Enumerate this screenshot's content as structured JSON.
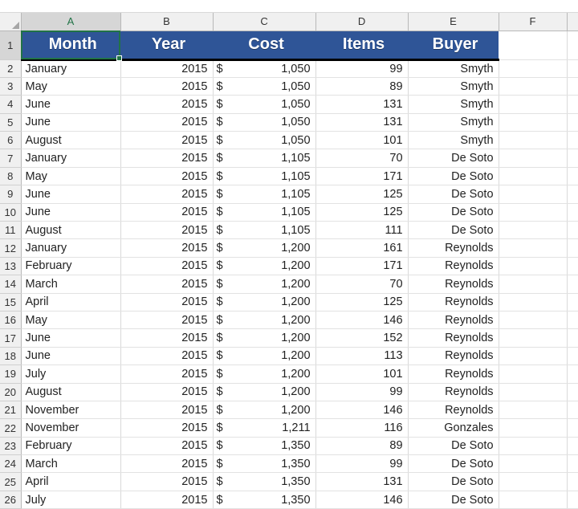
{
  "app": {
    "name": "spreadsheet",
    "accent_color": "#2f5597",
    "selection_color": "#217346"
  },
  "grid": {
    "select_all_icon": "select-all-triangle-icon",
    "column_letters": [
      "A",
      "B",
      "C",
      "D",
      "E",
      "F"
    ],
    "selected_column": "A",
    "selected_cell": "A1",
    "row_numbers": [
      1,
      2,
      3,
      4,
      5,
      6,
      7,
      8,
      9,
      10,
      11,
      12,
      13,
      14,
      15,
      16,
      17,
      18,
      19,
      20,
      21,
      22,
      23,
      24,
      25,
      26
    ]
  },
  "table": {
    "headers": [
      "Month",
      "Year",
      "Cost",
      "Items",
      "Buyer"
    ],
    "currency_symbol": "$",
    "rows": [
      {
        "row": 2,
        "month": "January",
        "year": "2015",
        "cost": "1,050",
        "items": "99",
        "buyer": "Smyth"
      },
      {
        "row": 3,
        "month": "May",
        "year": "2015",
        "cost": "1,050",
        "items": "89",
        "buyer": "Smyth"
      },
      {
        "row": 4,
        "month": "June",
        "year": "2015",
        "cost": "1,050",
        "items": "131",
        "buyer": "Smyth"
      },
      {
        "row": 5,
        "month": "June",
        "year": "2015",
        "cost": "1,050",
        "items": "131",
        "buyer": "Smyth"
      },
      {
        "row": 6,
        "month": "August",
        "year": "2015",
        "cost": "1,050",
        "items": "101",
        "buyer": "Smyth"
      },
      {
        "row": 7,
        "month": "January",
        "year": "2015",
        "cost": "1,105",
        "items": "70",
        "buyer": "De Soto"
      },
      {
        "row": 8,
        "month": "May",
        "year": "2015",
        "cost": "1,105",
        "items": "171",
        "buyer": "De Soto"
      },
      {
        "row": 9,
        "month": "June",
        "year": "2015",
        "cost": "1,105",
        "items": "125",
        "buyer": "De Soto"
      },
      {
        "row": 10,
        "month": "June",
        "year": "2015",
        "cost": "1,105",
        "items": "125",
        "buyer": "De Soto"
      },
      {
        "row": 11,
        "month": "August",
        "year": "2015",
        "cost": "1,105",
        "items": "111",
        "buyer": "De Soto"
      },
      {
        "row": 12,
        "month": "January",
        "year": "2015",
        "cost": "1,200",
        "items": "161",
        "buyer": "Reynolds"
      },
      {
        "row": 13,
        "month": "February",
        "year": "2015",
        "cost": "1,200",
        "items": "171",
        "buyer": "Reynolds"
      },
      {
        "row": 14,
        "month": "March",
        "year": "2015",
        "cost": "1,200",
        "items": "70",
        "buyer": "Reynolds"
      },
      {
        "row": 15,
        "month": "April",
        "year": "2015",
        "cost": "1,200",
        "items": "125",
        "buyer": "Reynolds"
      },
      {
        "row": 16,
        "month": "May",
        "year": "2015",
        "cost": "1,200",
        "items": "146",
        "buyer": "Reynolds"
      },
      {
        "row": 17,
        "month": "June",
        "year": "2015",
        "cost": "1,200",
        "items": "152",
        "buyer": "Reynolds"
      },
      {
        "row": 18,
        "month": "June",
        "year": "2015",
        "cost": "1,200",
        "items": "113",
        "buyer": "Reynolds"
      },
      {
        "row": 19,
        "month": "July",
        "year": "2015",
        "cost": "1,200",
        "items": "101",
        "buyer": "Reynolds"
      },
      {
        "row": 20,
        "month": "August",
        "year": "2015",
        "cost": "1,200",
        "items": "99",
        "buyer": "Reynolds"
      },
      {
        "row": 21,
        "month": "November",
        "year": "2015",
        "cost": "1,200",
        "items": "146",
        "buyer": "Reynolds"
      },
      {
        "row": 22,
        "month": "November",
        "year": "2015",
        "cost": "1,211",
        "items": "116",
        "buyer": "Gonzales"
      },
      {
        "row": 23,
        "month": "February",
        "year": "2015",
        "cost": "1,350",
        "items": "89",
        "buyer": "De Soto"
      },
      {
        "row": 24,
        "month": "March",
        "year": "2015",
        "cost": "1,350",
        "items": "99",
        "buyer": "De Soto"
      },
      {
        "row": 25,
        "month": "April",
        "year": "2015",
        "cost": "1,350",
        "items": "131",
        "buyer": "De Soto"
      },
      {
        "row": 26,
        "month": "July",
        "year": "2015",
        "cost": "1,350",
        "items": "146",
        "buyer": "De Soto"
      }
    ]
  }
}
